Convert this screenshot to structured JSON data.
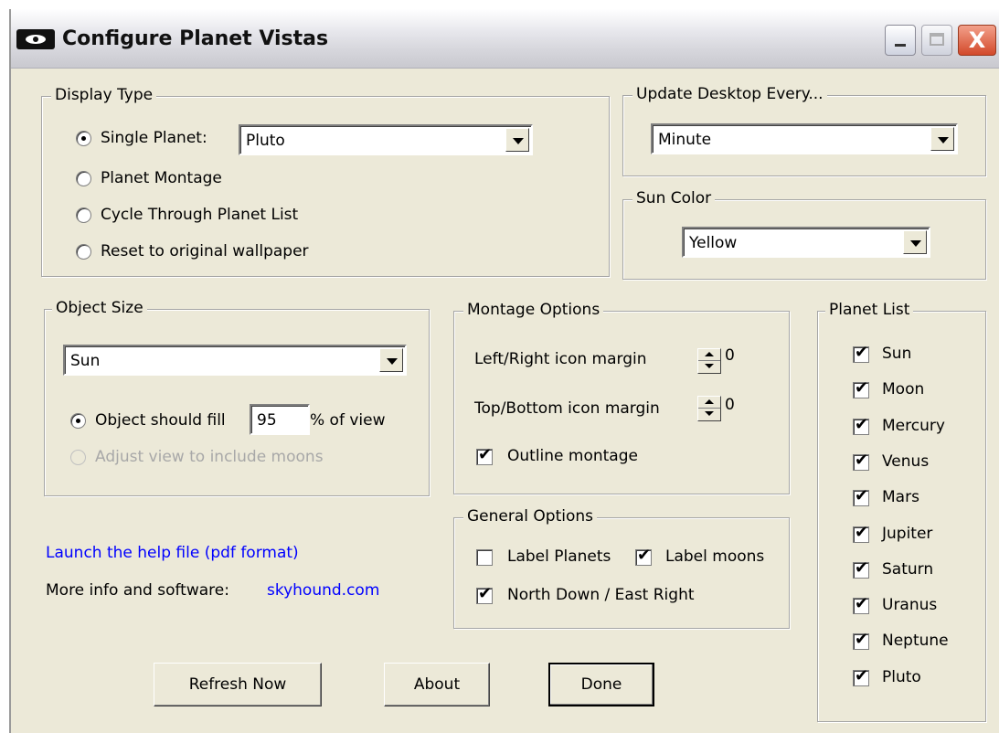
{
  "window": {
    "title": "Configure Planet Vistas",
    "close_glyph": "X"
  },
  "display_type": {
    "legend": "Display Type",
    "options": [
      {
        "label": "Single Planet:",
        "selected": true
      },
      {
        "label": "Planet Montage",
        "selected": false
      },
      {
        "label": "Cycle Through Planet List",
        "selected": false
      },
      {
        "label": "Reset to original wallpaper",
        "selected": false
      }
    ],
    "planet_select": "Pluto"
  },
  "update_desktop": {
    "legend": "Update Desktop Every...",
    "value": "Minute"
  },
  "sun_color": {
    "legend": "Sun Color",
    "value": "Yellow"
  },
  "object_size": {
    "legend": "Object Size",
    "object_select": "Sun",
    "fill_label": "Object should fill",
    "fill_value": "95",
    "fill_suffix": "% of view",
    "adjust_label": "Adjust view to include moons"
  },
  "montage_options": {
    "legend": "Montage Options",
    "lr_label": "Left/Right icon margin",
    "lr_value": "0",
    "tb_label": "Top/Bottom icon margin",
    "tb_value": "0",
    "outline_label": "Outline montage",
    "outline_checked": true
  },
  "general_options": {
    "legend": "General Options",
    "label_planets": "Label Planets",
    "label_planets_checked": false,
    "label_moons": "Label moons",
    "label_moons_checked": true,
    "north_down": "North Down / East Right",
    "north_down_checked": true
  },
  "planet_list": {
    "legend": "Planet List",
    "items": [
      {
        "name": "Sun",
        "checked": true
      },
      {
        "name": "Moon",
        "checked": true
      },
      {
        "name": "Mercury",
        "checked": true
      },
      {
        "name": "Venus",
        "checked": true
      },
      {
        "name": "Mars",
        "checked": true
      },
      {
        "name": "Jupiter",
        "checked": true
      },
      {
        "name": "Saturn",
        "checked": true
      },
      {
        "name": "Uranus",
        "checked": true
      },
      {
        "name": "Neptune",
        "checked": true
      },
      {
        "name": "Pluto",
        "checked": true
      }
    ]
  },
  "links": {
    "help": "Launch the help file (pdf format)",
    "more_info_label": "More info and software:",
    "website": "skyhound.com"
  },
  "buttons": {
    "refresh": "Refresh Now",
    "about": "About",
    "done": "Done"
  },
  "check_glyph": "✔"
}
